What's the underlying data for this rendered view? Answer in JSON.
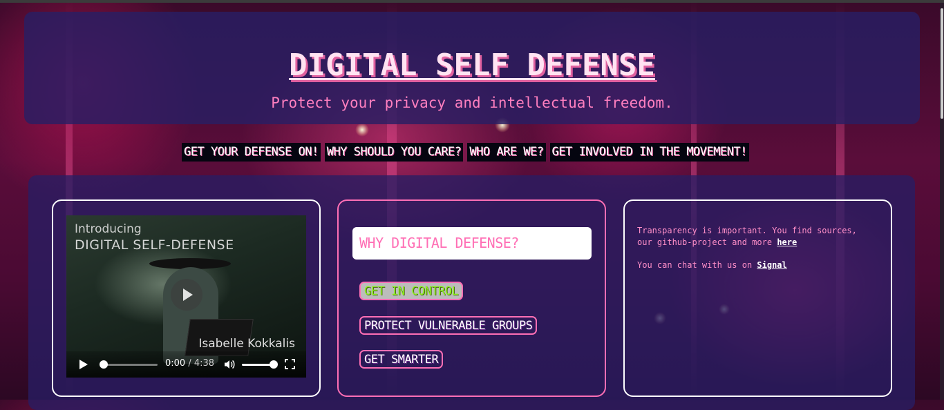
{
  "header": {
    "title": "DIGITAL SELF DEFENSE",
    "tagline": "Protect your privacy and intellectual freedom."
  },
  "nav": {
    "items": [
      {
        "label": "GET YOUR DEFENSE ON!"
      },
      {
        "label": "WHY SHOULD YOU CARE?"
      },
      {
        "label": "WHO ARE WE?"
      },
      {
        "label": "GET INVOLVED IN THE MOVEMENT!"
      }
    ]
  },
  "video": {
    "kicker": "Introducing",
    "title": "DIGITAL SELF-DEFENSE",
    "name": "Isabelle Kokkalis",
    "current_time": "0:00",
    "separator": "/",
    "duration": "4:38",
    "progress": 0,
    "volume": 1.0,
    "icons": {
      "big_play": "play-icon",
      "play": "play-icon",
      "volume": "volume-icon",
      "fullscreen": "fullscreen-icon"
    }
  },
  "why": {
    "heading": "WHY DIGITAL DEFENSE?",
    "buttons": [
      {
        "label": "GET IN CONTROL",
        "active": true
      },
      {
        "label": "PROTECT VULNERABLE GROUPS",
        "active": false
      },
      {
        "label": "GET SMARTER",
        "active": false
      }
    ]
  },
  "info": {
    "p1_text": "Transparency is important. You find sources, our github-project and more",
    "p1_link": "here",
    "p2_text": "You can chat with us on",
    "p2_link": "Signal"
  },
  "colors": {
    "accent_pink": "#ff6fb5",
    "panel": "#281e64",
    "active_text": "#8cf020"
  }
}
